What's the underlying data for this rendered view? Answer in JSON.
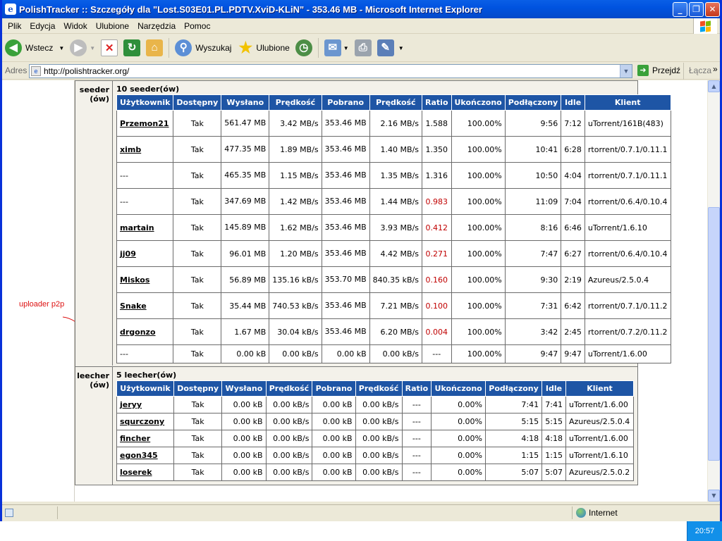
{
  "window": {
    "title": "PolishTracker :: Szczegóły dla \"Lost.S03E01.PL.PDTV.XviD-KLiN\" - 353.46 MB - Microsoft Internet Explorer"
  },
  "menu": [
    "Plik",
    "Edycja",
    "Widok",
    "Ulubione",
    "Narzędzia",
    "Pomoc"
  ],
  "toolbar": {
    "back": "Wstecz",
    "search": "Wyszukaj",
    "favorites": "Ulubione"
  },
  "address": {
    "label": "Adres",
    "url": "http://polishtracker.org/",
    "go": "Przejdź",
    "links": "Łącza"
  },
  "status": {
    "zone": "Internet"
  },
  "clock": "20:57",
  "annotation": "uploader p2p",
  "columns": [
    "Użytkownik",
    "Dostępny",
    "Wysłano",
    "Prędkość",
    "Pobrano",
    "Prędkość",
    "Ratio",
    "Ukończono",
    "Podłączony",
    "Idle",
    "Klient"
  ],
  "seeders": {
    "label": "seeder (ów)",
    "title": "10 seeder(ów)",
    "rows": [
      {
        "user": "Przemon21",
        "avail": "Tak",
        "up": "561.47 MB",
        "upspd": "3.42 MB/s",
        "down": "353.46 MB",
        "downspd": "2.16 MB/s",
        "ratio": "1.588",
        "done": "100.00%",
        "conn": "9:56",
        "idle": "7:12",
        "client": "uTorrent/161B(483)",
        "red": false,
        "linked": true
      },
      {
        "user": "ximb",
        "avail": "Tak",
        "up": "477.35 MB",
        "upspd": "1.89 MB/s",
        "down": "353.46 MB",
        "downspd": "1.40 MB/s",
        "ratio": "1.350",
        "done": "100.00%",
        "conn": "10:41",
        "idle": "6:28",
        "client": "rtorrent/0.7.1/0.11.1",
        "red": false,
        "linked": true
      },
      {
        "user": "---",
        "avail": "Tak",
        "up": "465.35 MB",
        "upspd": "1.15 MB/s",
        "down": "353.46 MB",
        "downspd": "1.35 MB/s",
        "ratio": "1.316",
        "done": "100.00%",
        "conn": "10:50",
        "idle": "4:04",
        "client": "rtorrent/0.7.1/0.11.1",
        "red": false,
        "linked": false
      },
      {
        "user": "---",
        "avail": "Tak",
        "up": "347.69 MB",
        "upspd": "1.42 MB/s",
        "down": "353.46 MB",
        "downspd": "1.44 MB/s",
        "ratio": "0.983",
        "done": "100.00%",
        "conn": "11:09",
        "idle": "7:04",
        "client": "rtorrent/0.6.4/0.10.4",
        "red": true,
        "linked": false
      },
      {
        "user": "martain",
        "avail": "Tak",
        "up": "145.89 MB",
        "upspd": "1.62 MB/s",
        "down": "353.46 MB",
        "downspd": "3.93 MB/s",
        "ratio": "0.412",
        "done": "100.00%",
        "conn": "8:16",
        "idle": "6:46",
        "client": "uTorrent/1.6.10",
        "red": true,
        "linked": true
      },
      {
        "user": "jj09",
        "avail": "Tak",
        "up": "96.01 MB",
        "upspd": "1.20 MB/s",
        "down": "353.46 MB",
        "downspd": "4.42 MB/s",
        "ratio": "0.271",
        "done": "100.00%",
        "conn": "7:47",
        "idle": "6:27",
        "client": "rtorrent/0.6.4/0.10.4",
        "red": true,
        "linked": true
      },
      {
        "user": "Miskos",
        "avail": "Tak",
        "up": "56.89 MB",
        "upspd": "135.16 kB/s",
        "down": "353.70 MB",
        "downspd": "840.35 kB/s",
        "ratio": "0.160",
        "done": "100.00%",
        "conn": "9:30",
        "idle": "2:19",
        "client": "Azureus/2.5.0.4",
        "red": true,
        "linked": true
      },
      {
        "user": "Snake",
        "avail": "Tak",
        "up": "35.44 MB",
        "upspd": "740.53 kB/s",
        "down": "353.46 MB",
        "downspd": "7.21 MB/s",
        "ratio": "0.100",
        "done": "100.00%",
        "conn": "7:31",
        "idle": "6:42",
        "client": "rtorrent/0.7.1/0.11.2",
        "red": true,
        "linked": true
      },
      {
        "user": "drgonzo",
        "avail": "Tak",
        "up": "1.67 MB",
        "upspd": "30.04 kB/s",
        "down": "353.46 MB",
        "downspd": "6.20 MB/s",
        "ratio": "0.004",
        "done": "100.00%",
        "conn": "3:42",
        "idle": "2:45",
        "client": "rtorrent/0.7.2/0.11.2",
        "red": true,
        "linked": true
      },
      {
        "user": "---",
        "avail": "Tak",
        "up": "0.00 kB",
        "upspd": "0.00 kB/s",
        "down": "0.00 kB",
        "downspd": "0.00 kB/s",
        "ratio": "---",
        "done": "100.00%",
        "conn": "9:47",
        "idle": "9:47",
        "client": "uTorrent/1.6.00",
        "red": false,
        "linked": false
      }
    ]
  },
  "leechers": {
    "label": "leecher (ów)",
    "title": "5 leecher(ów)",
    "rows": [
      {
        "user": "jeryy",
        "avail": "Tak",
        "up": "0.00 kB",
        "upspd": "0.00 kB/s",
        "down": "0.00 kB",
        "downspd": "0.00 kB/s",
        "ratio": "---",
        "done": "0.00%",
        "conn": "7:41",
        "idle": "7:41",
        "client": "uTorrent/1.6.00",
        "red": false,
        "linked": true
      },
      {
        "user": "squrczony",
        "avail": "Tak",
        "up": "0.00 kB",
        "upspd": "0.00 kB/s",
        "down": "0.00 kB",
        "downspd": "0.00 kB/s",
        "ratio": "---",
        "done": "0.00%",
        "conn": "5:15",
        "idle": "5:15",
        "client": "Azureus/2.5.0.4",
        "red": false,
        "linked": true
      },
      {
        "user": "fincher",
        "avail": "Tak",
        "up": "0.00 kB",
        "upspd": "0.00 kB/s",
        "down": "0.00 kB",
        "downspd": "0.00 kB/s",
        "ratio": "---",
        "done": "0.00%",
        "conn": "4:18",
        "idle": "4:18",
        "client": "uTorrent/1.6.00",
        "red": false,
        "linked": true
      },
      {
        "user": "egon345",
        "avail": "Tak",
        "up": "0.00 kB",
        "upspd": "0.00 kB/s",
        "down": "0.00 kB",
        "downspd": "0.00 kB/s",
        "ratio": "---",
        "done": "0.00%",
        "conn": "1:15",
        "idle": "1:15",
        "client": "uTorrent/1.6.10",
        "red": false,
        "linked": true
      },
      {
        "user": "loserek",
        "avail": "Tak",
        "up": "0.00 kB",
        "upspd": "0.00 kB/s",
        "down": "0.00 kB",
        "downspd": "0.00 kB/s",
        "ratio": "---",
        "done": "0.00%",
        "conn": "5:07",
        "idle": "5:07",
        "client": "Azureus/2.5.0.2",
        "red": false,
        "linked": true
      }
    ]
  }
}
